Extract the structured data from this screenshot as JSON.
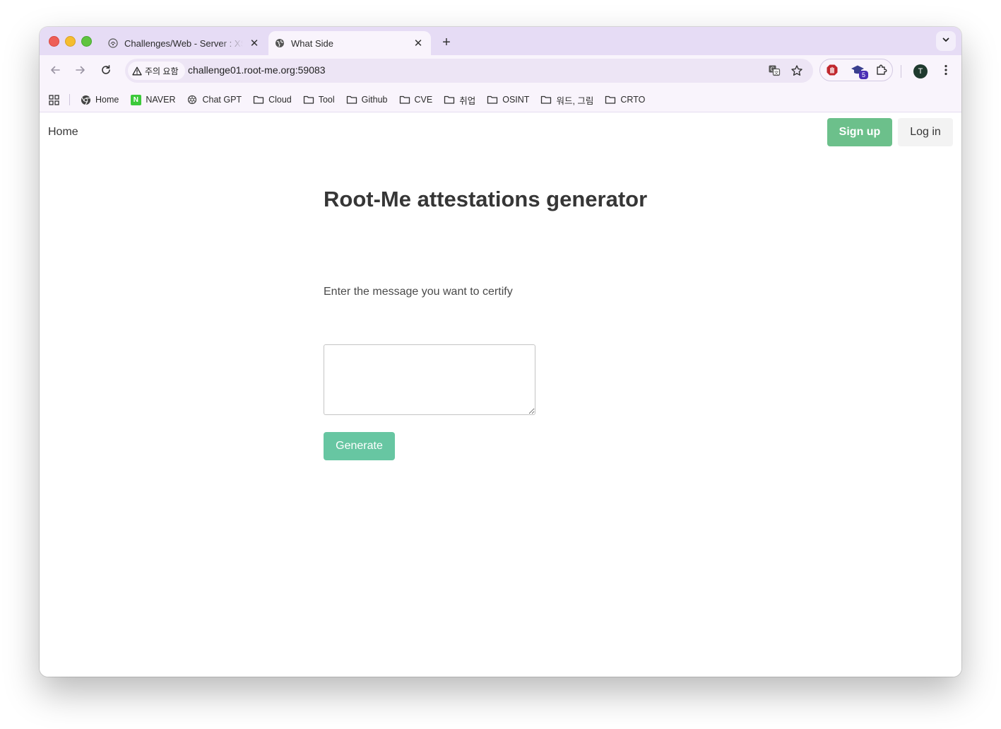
{
  "browser": {
    "tabs": [
      {
        "title": "Challenges/Web - Server : XSS",
        "active": false,
        "icon": "root-me-icon"
      },
      {
        "title": "What Side",
        "active": true,
        "icon": "globe-icon"
      }
    ],
    "close_glyph": "✕",
    "new_tab_glyph": "+",
    "security_chip": "주의 요함",
    "url": "challenge01.root-me.org:59083",
    "extension_badge": "5",
    "profile_initial": "T",
    "bookmarks": [
      {
        "label": "Home",
        "icon": "chrome-icon"
      },
      {
        "label": "NAVER",
        "icon": "naver-icon"
      },
      {
        "label": "Chat GPT",
        "icon": "openai-icon"
      },
      {
        "label": "Cloud",
        "icon": "folder-icon"
      },
      {
        "label": "Tool",
        "icon": "folder-icon"
      },
      {
        "label": "Github",
        "icon": "folder-icon"
      },
      {
        "label": "CVE",
        "icon": "folder-icon"
      },
      {
        "label": "취업",
        "icon": "folder-icon"
      },
      {
        "label": "OSINT",
        "icon": "folder-icon"
      },
      {
        "label": "워드, 그림",
        "icon": "folder-icon"
      },
      {
        "label": "CRTO",
        "icon": "folder-icon"
      }
    ]
  },
  "page": {
    "nav": {
      "home": "Home",
      "signup": "Sign up",
      "login": "Log in"
    },
    "title": "Root-Me attestations generator",
    "form": {
      "label": "Enter the message you want to certify",
      "message_value": "",
      "submit": "Generate"
    }
  },
  "colors": {
    "tab_strip": "#e6dcf5",
    "toolbar": "#f9f4fc",
    "signup_button": "#6cc08b",
    "generate_button": "#67c6a2",
    "login_button": "#f3f3f3"
  }
}
